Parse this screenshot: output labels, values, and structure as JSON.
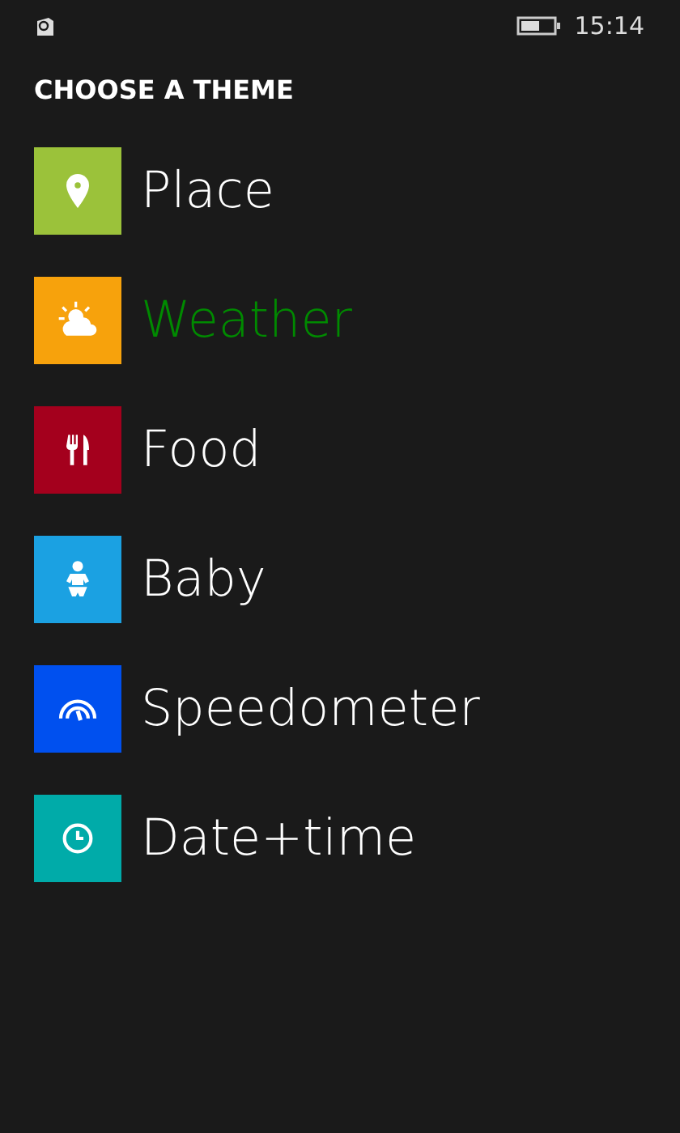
{
  "status_bar": {
    "time": "15:14"
  },
  "title": "CHOOSE A THEME",
  "themes": [
    {
      "label": "Place",
      "kind": "pin",
      "color": "#9bc23a",
      "selected": false
    },
    {
      "label": "Weather",
      "kind": "weather",
      "color": "#f7a20c",
      "selected": true
    },
    {
      "label": "Food",
      "kind": "cutlery",
      "color": "#a4001d",
      "selected": false
    },
    {
      "label": "Baby",
      "kind": "baby",
      "color": "#1ba1e2",
      "selected": false
    },
    {
      "label": "Speedometer",
      "kind": "gauge",
      "color": "#0050ef",
      "selected": false
    },
    {
      "label": "Date+time",
      "kind": "clock",
      "color": "#00aba9",
      "selected": false
    }
  ]
}
